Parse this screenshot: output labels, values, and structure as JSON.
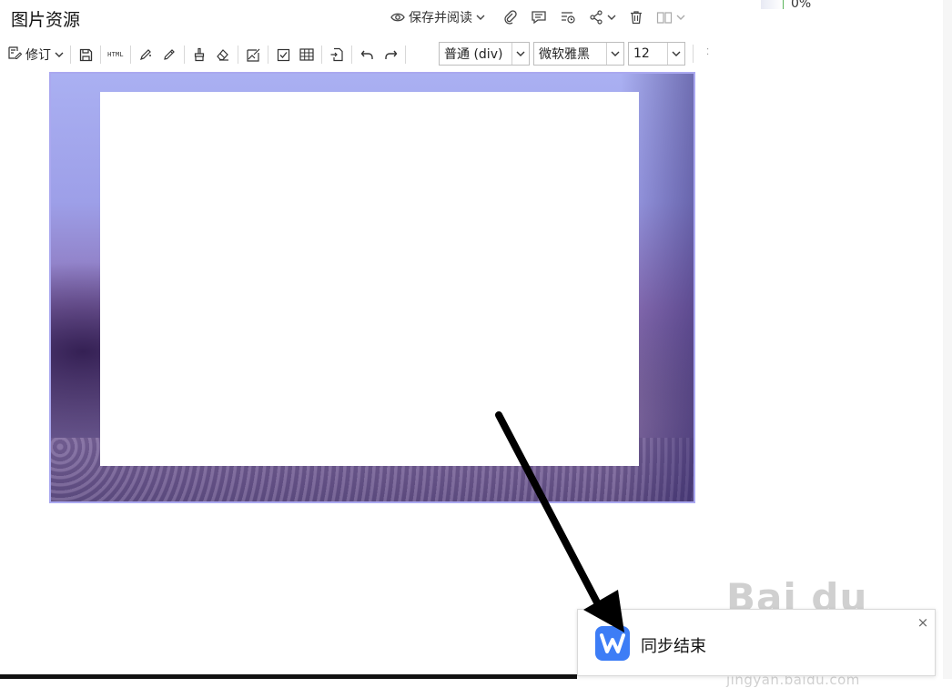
{
  "header": {
    "title": "图片资源",
    "save_and_read_label": "保存并阅读",
    "progress_text": "0%"
  },
  "toolbar": {
    "revise_label": "修订",
    "html_label": "HTML",
    "paragraph_format": "普通 (div)",
    "font_family": "微软雅黑",
    "font_size": "12"
  },
  "notification": {
    "message": "同步结束",
    "close_glyph": "×",
    "app_icon_letter": "W"
  },
  "watermark": {
    "main": "Bai du 经验",
    "sub": "jingyan.baidu.com"
  },
  "colors": {
    "accent_blue": "#3d7df6",
    "image_border": "#aaa8f0"
  }
}
